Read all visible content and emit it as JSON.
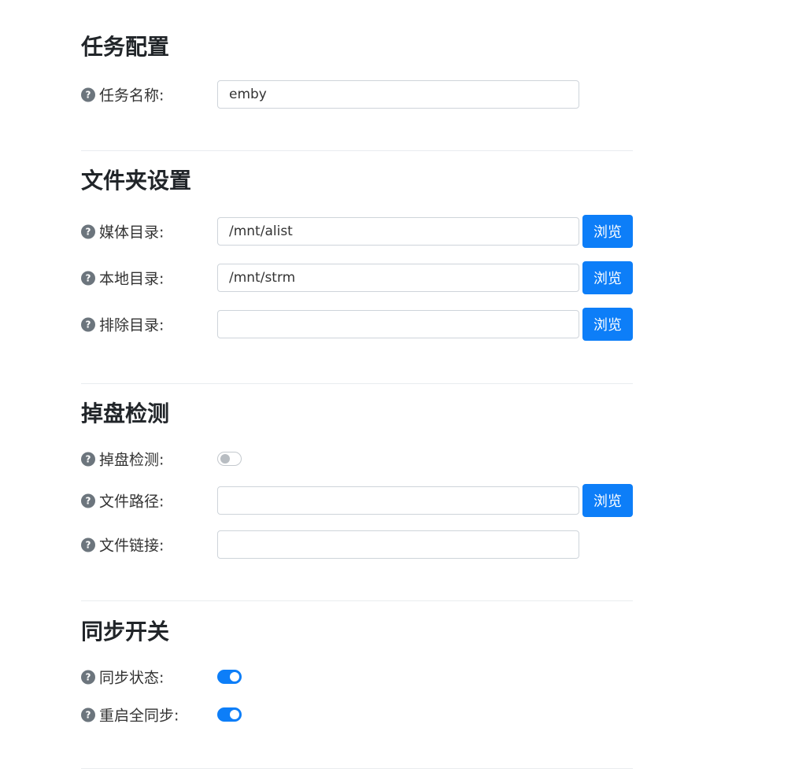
{
  "sections": {
    "task": {
      "title": "任务配置",
      "task_name_label": "任务名称:",
      "task_name_value": "emby"
    },
    "folder": {
      "title": "文件夹设置",
      "media_dir_label": "媒体目录:",
      "media_dir_value": "/mnt/alist",
      "local_dir_label": "本地目录:",
      "local_dir_value": "/mnt/strm",
      "exclude_dir_label": "排除目录:",
      "exclude_dir_value": ""
    },
    "drop": {
      "title": "掉盘检测",
      "drop_check_label": "掉盘检测:",
      "drop_check_enabled": false,
      "file_path_label": "文件路径:",
      "file_path_value": "",
      "file_link_label": "文件链接:",
      "file_link_value": ""
    },
    "sync": {
      "title": "同步开关",
      "sync_status_label": "同步状态:",
      "sync_status_enabled": true,
      "restart_full_sync_label": "重启全同步:",
      "restart_full_sync_enabled": true
    }
  },
  "common": {
    "browse_label": "浏览",
    "help_glyph": "?"
  },
  "colors": {
    "accent": "#0d7ef8",
    "help_icon": "#6c757d",
    "divider": "#e9ecef"
  }
}
